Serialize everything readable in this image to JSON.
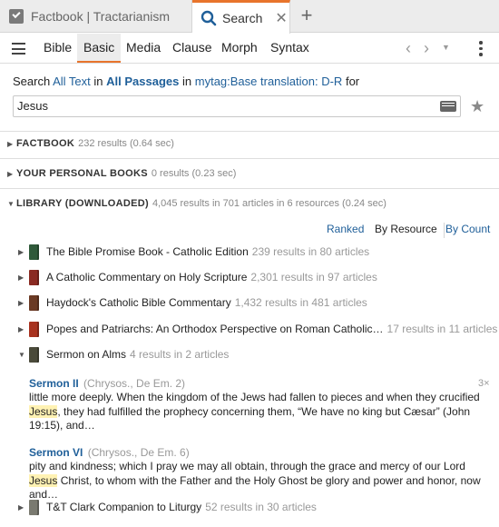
{
  "tabs": [
    {
      "label": "Factbook | Tractarianism",
      "icon": "factbook-check-icon"
    },
    {
      "label": "Search",
      "icon": "search-icon",
      "active": true
    }
  ],
  "toolbar": {
    "modes": [
      "Bible",
      "Basic",
      "Media",
      "Clause",
      "Morph",
      "Syntax"
    ],
    "active_mode": "Basic"
  },
  "scope": {
    "prefix": "Search",
    "text_link": "All Text",
    "in1": "in",
    "passages_link": "All Passages",
    "in2": "in",
    "resource_link": "mytag:Base translation: D-R",
    "suffix": "for"
  },
  "search": {
    "query": "Jesus"
  },
  "sections": {
    "factbook": {
      "title": "FACTBOOK",
      "meta": "232 results (0.64 sec)"
    },
    "personal": {
      "title": "YOUR PERSONAL BOOKS",
      "meta": "0 results (0.23 sec)"
    },
    "library": {
      "title": "LIBRARY (DOWNLOADED)",
      "meta": "4,045 results in 701 articles in 6 resources (0.24 sec)"
    }
  },
  "sort": {
    "ranked": "Ranked",
    "by_resource": "By Resource",
    "by_count": "By Count"
  },
  "resources": [
    {
      "title": "The Bible Promise Book - Catholic Edition",
      "meta": "239 results in 80 articles",
      "color": "#2f5a3a"
    },
    {
      "title": "A Catholic Commentary on Holy Scripture",
      "meta": "2,301 results in 97 articles",
      "color": "#8a2a22"
    },
    {
      "title": "Haydock's Catholic Bible Commentary",
      "meta": "1,432 results in 481 articles",
      "color": "#6b3a24"
    },
    {
      "title": "Popes and Patriarchs: An Orthodox Perspective on Roman Catholic…",
      "meta": "17 results in 11 articles",
      "color": "#a8321f"
    },
    {
      "title": "Sermon on Alms",
      "meta": "4 results in 2 articles",
      "color": "#4a4a3a"
    },
    {
      "title": "T&T Clark Companion to Liturgy",
      "meta": "52 results in 30 articles",
      "color": "#7a7a70"
    }
  ],
  "hits": [
    {
      "title": "Sermon II",
      "source": "(Chrysos., De Em. 2)",
      "count": "3×",
      "pre": "little more deeply. When the kingdom of the Jews had fallen to pieces and when they crucified ",
      "match": "Jesus",
      "post": ", they had fulfilled the prophecy concerning them, “We have no king but Cæsar” (John 19:15), and…"
    },
    {
      "title": "Sermon VI",
      "source": "(Chrysos., De Em. 6)",
      "pre": "pity and kindness; which I pray we may all obtain, through the grace and mercy of our Lord ",
      "match": "Jesus",
      "post": " Christ, to whom with the Father and the Holy Ghost be glory and power and honor, now and…"
    }
  ],
  "colors": {
    "accent": "#e8742c",
    "link": "#1f5f99",
    "highlight": "#fff2b3"
  }
}
